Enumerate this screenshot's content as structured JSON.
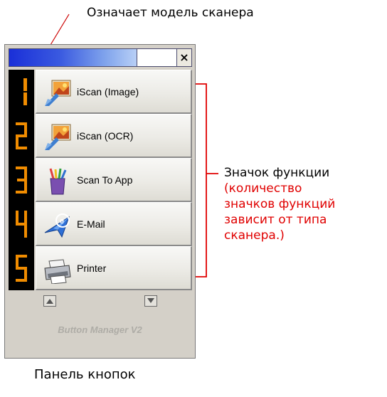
{
  "annotations": {
    "model_label": "Означает модель сканера",
    "function_label_line1": "Значок функции",
    "function_note_line1": "(количество",
    "function_note_line2": "значков функций",
    "function_note_line3": "зависит от типа",
    "function_note_line4": "сканера.)",
    "panel_label": "Панель кнопок"
  },
  "window": {
    "close_symbol": "×",
    "title_gradient_colors": [
      "#1a2fd8",
      "#b8cff6"
    ]
  },
  "buttons": [
    {
      "digit": 1,
      "label": "iScan (Image)",
      "icon": "image-scan-icon"
    },
    {
      "digit": 2,
      "label": "iScan (OCR)",
      "icon": "ocr-scan-icon"
    },
    {
      "digit": 3,
      "label": "Scan To App",
      "icon": "app-icon"
    },
    {
      "digit": 4,
      "label": "E-Mail",
      "icon": "email-icon"
    },
    {
      "digit": 5,
      "label": "Printer",
      "icon": "printer-icon"
    }
  ],
  "navigation": {
    "up_icon": "arrow-up-icon",
    "down_icon": "arrow-down-icon"
  },
  "brand": "Button Manager V2",
  "colors": {
    "digit_segment": "#f08c00",
    "bracket": "#e00000",
    "note_text": "#e00000"
  }
}
